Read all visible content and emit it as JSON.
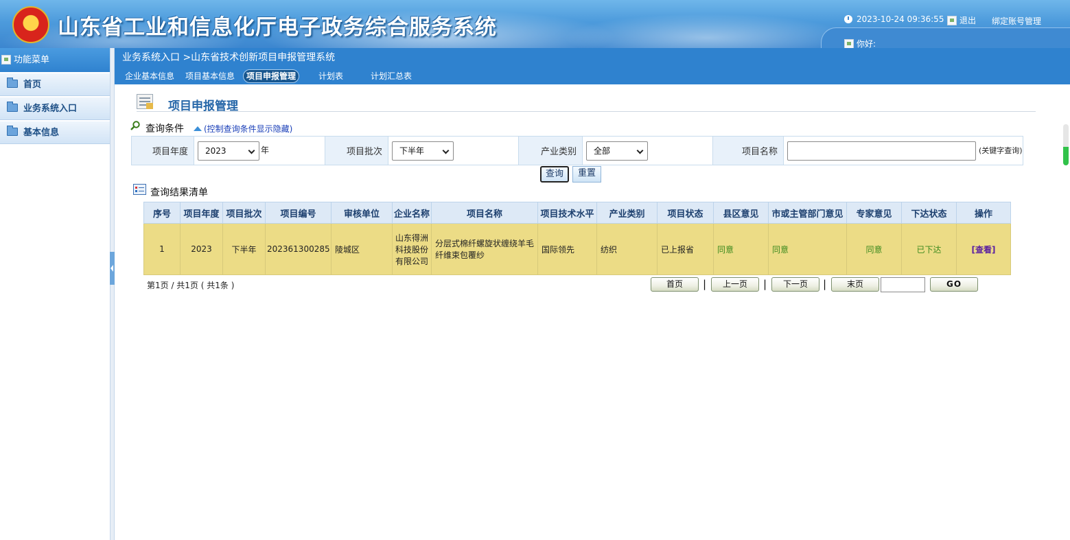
{
  "header": {
    "title": "山东省工业和信息化厅电子政务综合服务系统",
    "datetime": "2023-10-24 09:36:55",
    "logout": "退出",
    "bind_account": "绑定账号管理",
    "greeting": "你好:"
  },
  "sidebar": {
    "heading": "功能菜单",
    "items": [
      {
        "label": "首页",
        "icon": "folder-icon"
      },
      {
        "label": "业务系统入口",
        "icon": "folder-icon"
      },
      {
        "label": "基本信息",
        "icon": "folder-icon"
      }
    ]
  },
  "breadcrumb": "业务系统入口 >山东省技术创新项目申报管理系统",
  "tabs": [
    {
      "label": "企业基本信息",
      "active": false
    },
    {
      "label": "项目基本信息",
      "active": false
    },
    {
      "label": "项目申报管理",
      "active": true
    },
    {
      "label": "计划表",
      "active": false
    },
    {
      "label": "计划汇总表",
      "active": false
    }
  ],
  "page_title": "项目申报管理",
  "query": {
    "label": "查询条件",
    "toggle_link": "(控制查询条件显示隐藏)",
    "year_label": "项目年度",
    "year_value": "2023",
    "year_unit": "年",
    "batch_label": "项目批次",
    "batch_value": "下半年",
    "industry_label": "产业类别",
    "industry_value": "全部",
    "name_label": "项目名称",
    "name_value": "",
    "name_hint": "(关键字查询)",
    "search_button": "查询",
    "reset_button": "重置"
  },
  "results": {
    "label": "查询结果清单",
    "columns": [
      "序号",
      "项目年度",
      "项目批次",
      "项目编号",
      "审核单位",
      "企业名称",
      "项目名称",
      "项目技术水平",
      "产业类别",
      "项目状态",
      "县区意见",
      "市或主管部门意见",
      "专家意见",
      "下达状态",
      "操作"
    ],
    "rows": [
      {
        "index": "1",
        "year": "2023",
        "batch": "下半年",
        "code": "202361300285",
        "audit_unit": "陵城区",
        "company": "山东得洲科技股份有限公司",
        "project_name": "分层式棉纤螺旋状缠绕羊毛纤维束包覆纱",
        "tech_level": "国际领先",
        "industry": "纺织",
        "status": "已上报省",
        "county_opinion": "同意",
        "city_opinion": "同意",
        "expert_opinion": "同意",
        "issue_status": "已下达",
        "action": "[查看]"
      }
    ]
  },
  "pagination": {
    "info": "第1页 / 共1页 ( 共1条 )",
    "first": "首页",
    "prev": "上一页",
    "next": "下一页",
    "last": "末页",
    "sep": "|",
    "page_input": "",
    "go": "GO"
  },
  "colors": {
    "header_blue": "#3c86cf",
    "nav_blue": "#2f82cf",
    "row_highlight": "#ecdc86",
    "opinion_green": "#3d8a1e",
    "action_purple": "#5a1fa0"
  }
}
